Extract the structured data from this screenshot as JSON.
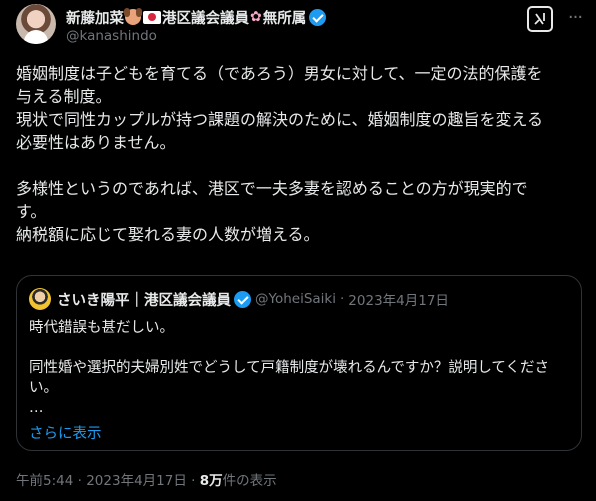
{
  "author": {
    "name": "新藤加菜",
    "title": "港区議会議員",
    "affiliation": "無所属",
    "handle": "@kanashindo"
  },
  "tweet": {
    "text": "婚姻制度は子どもを育てる（であろう）男女に対して、一定の法的保護を\n与える制度。\n現状で同性カップルが持つ課題の解決のために、婚姻制度の趣旨を変える\n必要性はありません。\n\n多様性というのであれば、港区で一夫多妻を認めることの方が現実的で\nす。\n納税額に応じて娶れる妻の人数が増える。"
  },
  "quoted": {
    "name": "さいき陽平｜港区議会議員",
    "handle": "@YoheiSaiki",
    "sep": "·",
    "date": "2023年4月17日",
    "text": "時代錯誤も甚だしい。\n\n同性婚や選択的夫婦別姓でどうして戸籍制度が壊れるんですか？説明してくださ\nい。\n…",
    "show_more": "さらに表示"
  },
  "footer": {
    "time": "午前5:44",
    "sep1": "·",
    "date": "2023年4月17日",
    "sep2": "·",
    "views": "8万",
    "views_label": "件の表示"
  },
  "icons": {
    "verified": "verified-badge-icon",
    "grok": "grok-icon",
    "more": "more-icon"
  },
  "colors": {
    "background": "#000000",
    "text": "#e7e9ea",
    "secondary": "#71767b",
    "accent": "#1d9bf0",
    "border": "#2f3336"
  }
}
